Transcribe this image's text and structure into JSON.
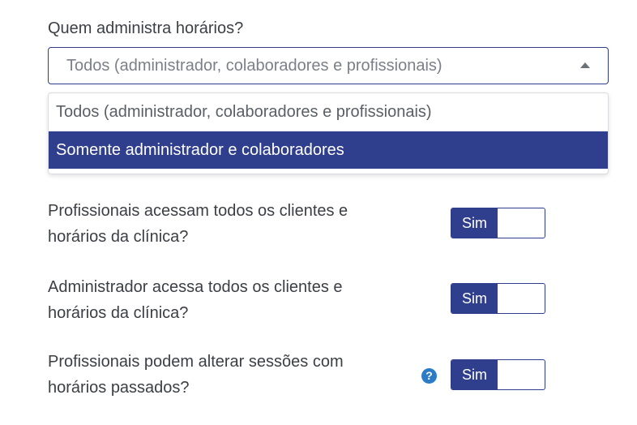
{
  "admin_schedule": {
    "label": "Quem administra horários?",
    "selected": "Todos (administrador, colaboradores e profissionais)",
    "options": [
      "Todos (administrador, colaboradores e profissionais)",
      "Somente administrador e colaboradores"
    ],
    "highlighted_option": "Somente administrador e colaboradores"
  },
  "settings": [
    {
      "question": "Profissionais acessam todos os clientes e horários da clínica?",
      "toggle_label": "Sim",
      "value": true
    },
    {
      "question": "Administrador acessa todos os clientes e horários da clínica?",
      "toggle_label": "Sim",
      "value": true
    },
    {
      "question": "Profissionais podem alterar sessões com horários passados?",
      "toggle_label": "Sim",
      "value": true,
      "help_icon": "?"
    }
  ],
  "colors": {
    "primary": "#303e8e",
    "help": "#2c7bc6",
    "text": "#3b3f45",
    "muted": "#7b8088"
  }
}
